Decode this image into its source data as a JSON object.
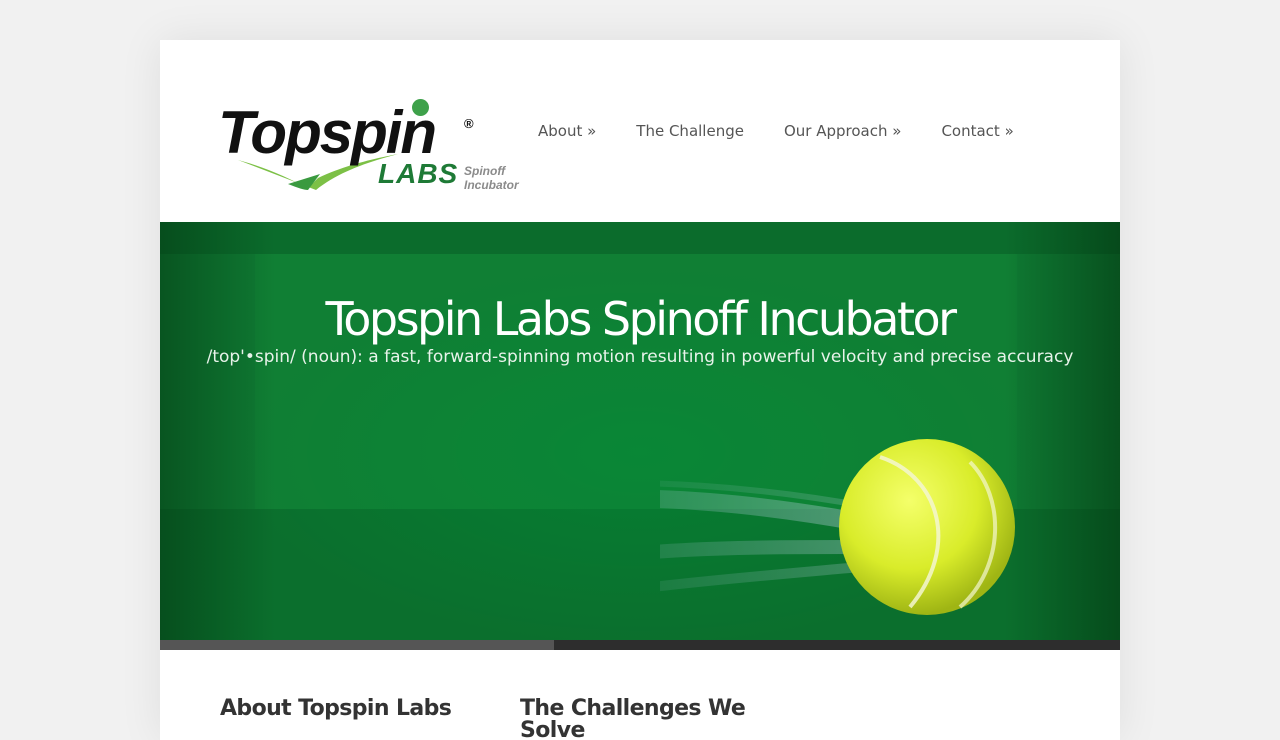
{
  "header": {
    "logo": {
      "wordmark": "Topspin",
      "registered": "®",
      "labs": "LABS",
      "tagline_line1": "Spinoff",
      "tagline_line2": "Incubator"
    },
    "nav": [
      {
        "label": "About »"
      },
      {
        "label": "The Challenge"
      },
      {
        "label": "Our Approach »"
      },
      {
        "label": "Contact »"
      }
    ]
  },
  "hero": {
    "title": "Topspin Labs Spinoff Incubator",
    "subtitle": "/top'•spin/ (noun): a fast, forward-spinning motion resulting in powerful velocity and precise accuracy",
    "slide_progress": 0.41
  },
  "content": {
    "col1_title": "About Topspin Labs",
    "col2_title": "The Challenges We Solve"
  },
  "colors": {
    "brand_green": "#1e7a36",
    "hero_green": "#0f7a33",
    "text_dark": "#333333",
    "nav_text": "#555555"
  }
}
